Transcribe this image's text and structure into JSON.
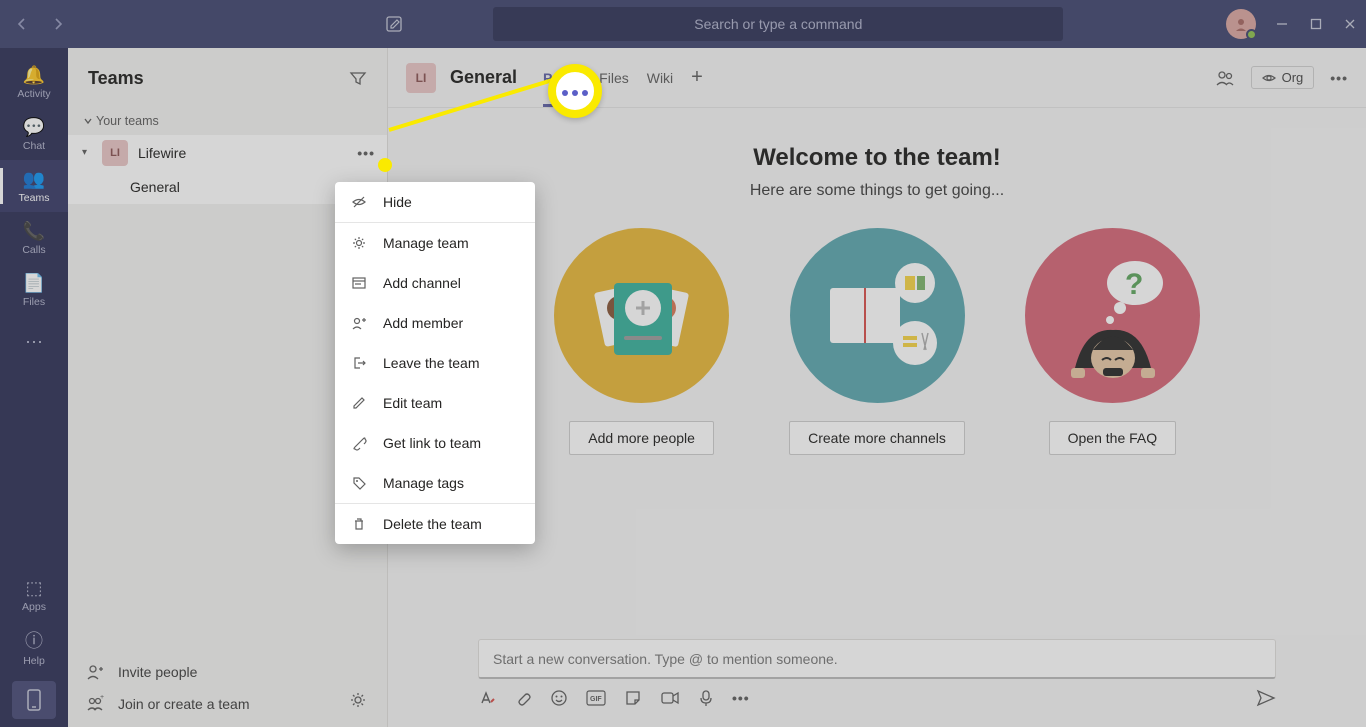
{
  "titlebar": {
    "search_placeholder": "Search or type a command"
  },
  "rail": {
    "activity": "Activity",
    "chat": "Chat",
    "teams": "Teams",
    "calls": "Calls",
    "files": "Files",
    "apps": "Apps",
    "help": "Help"
  },
  "teams_pane": {
    "title": "Teams",
    "group_label": "Your teams",
    "team_initials": "LI",
    "team_name": "Lifewire",
    "channel_name": "General",
    "invite_label": "Invite people",
    "join_label": "Join or create a team"
  },
  "channel_header": {
    "avatar_initials": "LI",
    "title": "General",
    "tabs": {
      "posts": "Posts",
      "files": "Files",
      "wiki": "Wiki"
    },
    "org_label": "Org"
  },
  "welcome": {
    "heading": "Welcome to the team!",
    "sub": "Here are some things to get going...",
    "card1_btn": "Add more people",
    "card2_btn": "Create more channels",
    "card3_btn": "Open the FAQ"
  },
  "compose": {
    "placeholder": "Start a new conversation. Type @ to mention someone."
  },
  "context_menu": {
    "hide": "Hide",
    "manage_team": "Manage team",
    "add_channel": "Add channel",
    "add_member": "Add member",
    "leave_team": "Leave the team",
    "edit_team": "Edit team",
    "get_link": "Get link to team",
    "manage_tags": "Manage tags",
    "delete_team": "Delete the team"
  }
}
